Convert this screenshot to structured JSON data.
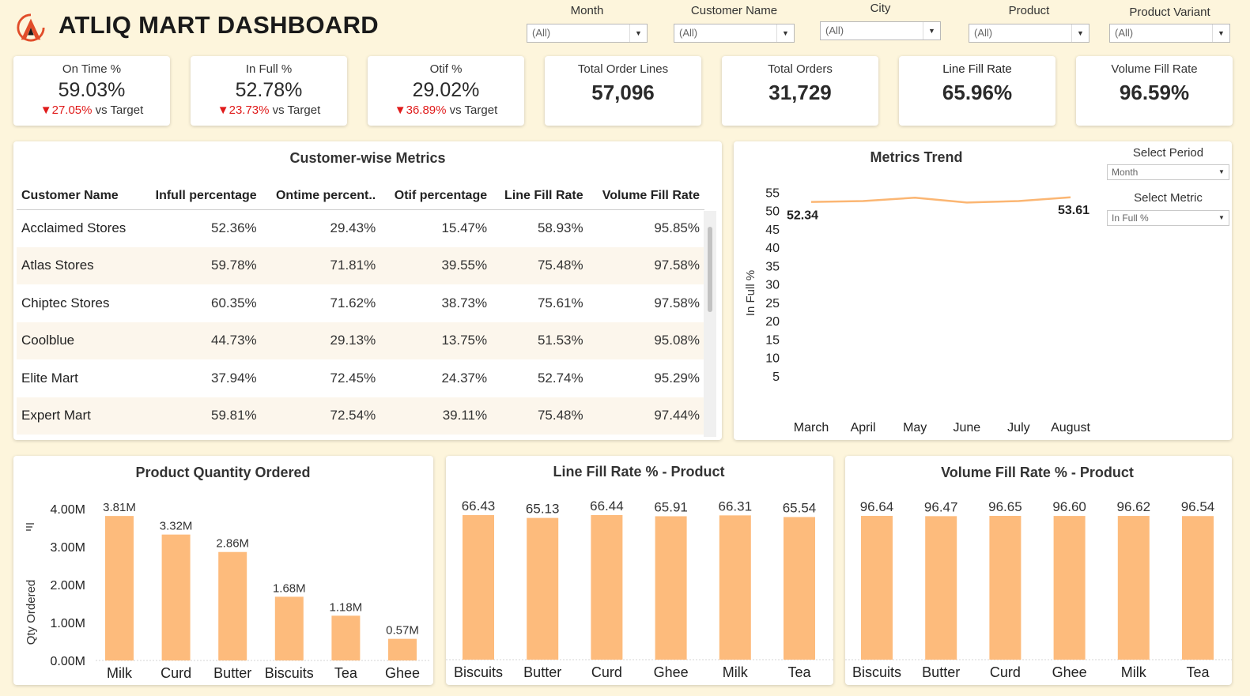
{
  "app": {
    "title": "ATLIQ MART DASHBOARD"
  },
  "filters": [
    {
      "label": "Month",
      "value": "(All)"
    },
    {
      "label": "Customer Name",
      "value": "(All)"
    },
    {
      "label": "City",
      "value": "(All)"
    },
    {
      "label": "Product",
      "value": "(All)"
    },
    {
      "label": "Product Variant",
      "value": "(All)"
    }
  ],
  "kpis": [
    {
      "label": "On Time  %",
      "value": "59.03%",
      "delta": "27.05%",
      "delta_suffix": " vs Target"
    },
    {
      "label": "In Full %",
      "value": "52.78%",
      "delta": "23.73%",
      "delta_suffix": " vs Target"
    },
    {
      "label": "Otif  %",
      "value": "29.02%",
      "delta": "36.89%",
      "delta_suffix": " vs Target"
    },
    {
      "label": "Total Order Lines",
      "value": "57,096"
    },
    {
      "label": "Total Orders",
      "value": "31,729"
    },
    {
      "label": "Line Fill Rate",
      "value": "65.96%"
    },
    {
      "label": "Volume Fill Rate",
      "value": "96.59%"
    }
  ],
  "customer_table": {
    "title": "Customer-wise Metrics",
    "columns": [
      "Customer Name",
      "Infull percentage",
      "Ontime percent..",
      "Otif percentage",
      "Line Fill Rate",
      "Volume Fill Rate"
    ],
    "rows": [
      [
        "Acclaimed Stores",
        "52.36%",
        "29.43%",
        "15.47%",
        "58.93%",
        "95.85%"
      ],
      [
        "Atlas Stores",
        "59.78%",
        "71.81%",
        "39.55%",
        "75.48%",
        "97.58%"
      ],
      [
        "Chiptec Stores",
        "60.35%",
        "71.62%",
        "38.73%",
        "75.61%",
        "97.58%"
      ],
      [
        "Coolblue",
        "44.73%",
        "29.13%",
        "13.75%",
        "51.53%",
        "95.08%"
      ],
      [
        "Elite Mart",
        "37.94%",
        "72.45%",
        "24.37%",
        "52.74%",
        "95.29%"
      ],
      [
        "Expert Mart",
        "59.81%",
        "72.54%",
        "39.11%",
        "75.48%",
        "97.44%"
      ]
    ]
  },
  "trend_controls": {
    "period_label": "Select Period",
    "period_value": "Month",
    "metric_label": "Select Metric",
    "metric_value": "In Full %"
  },
  "colors": {
    "bar": "#fdbb7c",
    "line": "#fbb673",
    "down_arrow": "#e01b1b",
    "background": "#fdf5dc"
  },
  "chart_data": [
    {
      "type": "line",
      "title": "Metrics Trend",
      "ylabel": "In Full %",
      "x": [
        "March",
        "April",
        "May",
        "June",
        "July",
        "August"
      ],
      "values": [
        52.34,
        52.6,
        53.5,
        52.2,
        52.6,
        53.61
      ],
      "yticks": [
        5,
        10,
        15,
        20,
        25,
        30,
        35,
        40,
        45,
        50,
        55
      ],
      "ylim": [
        0,
        57
      ],
      "end_labels": [
        "52.34",
        "53.61"
      ],
      "grid": false
    },
    {
      "type": "bar",
      "title": "Product Quantity Ordered",
      "ylabel": "Qty Ordered",
      "categories": [
        "Milk",
        "Curd",
        "Butter",
        "Biscuits",
        "Tea",
        "Ghee"
      ],
      "values": [
        3.81,
        3.32,
        2.86,
        1.68,
        1.18,
        0.57
      ],
      "value_labels": [
        "3.81M",
        "3.32M",
        "2.86M",
        "1.68M",
        "1.18M",
        "0.57M"
      ],
      "yticks": [
        "0.00M",
        "1.00M",
        "2.00M",
        "3.00M",
        "4.00M"
      ],
      "ylim": [
        0,
        4.0
      ]
    },
    {
      "type": "bar",
      "title": "Line Fill Rate % - Product",
      "categories": [
        "Biscuits",
        "Butter",
        "Curd",
        "Ghee",
        "Milk",
        "Tea"
      ],
      "values": [
        66.43,
        65.13,
        66.44,
        65.91,
        66.31,
        65.54
      ],
      "value_labels": [
        "66.43",
        "65.13",
        "66.44",
        "65.91",
        "66.31",
        "65.54"
      ],
      "ylim": [
        0,
        66.44
      ]
    },
    {
      "type": "bar",
      "title": "Volume Fill Rate % - Product",
      "categories": [
        "Biscuits",
        "Butter",
        "Curd",
        "Ghee",
        "Milk",
        "Tea"
      ],
      "values": [
        96.64,
        96.47,
        96.65,
        96.6,
        96.62,
        96.54
      ],
      "value_labels": [
        "96.64",
        "96.47",
        "96.65",
        "96.60",
        "96.62",
        "96.54"
      ],
      "ylim": [
        0,
        96.65
      ]
    }
  ]
}
